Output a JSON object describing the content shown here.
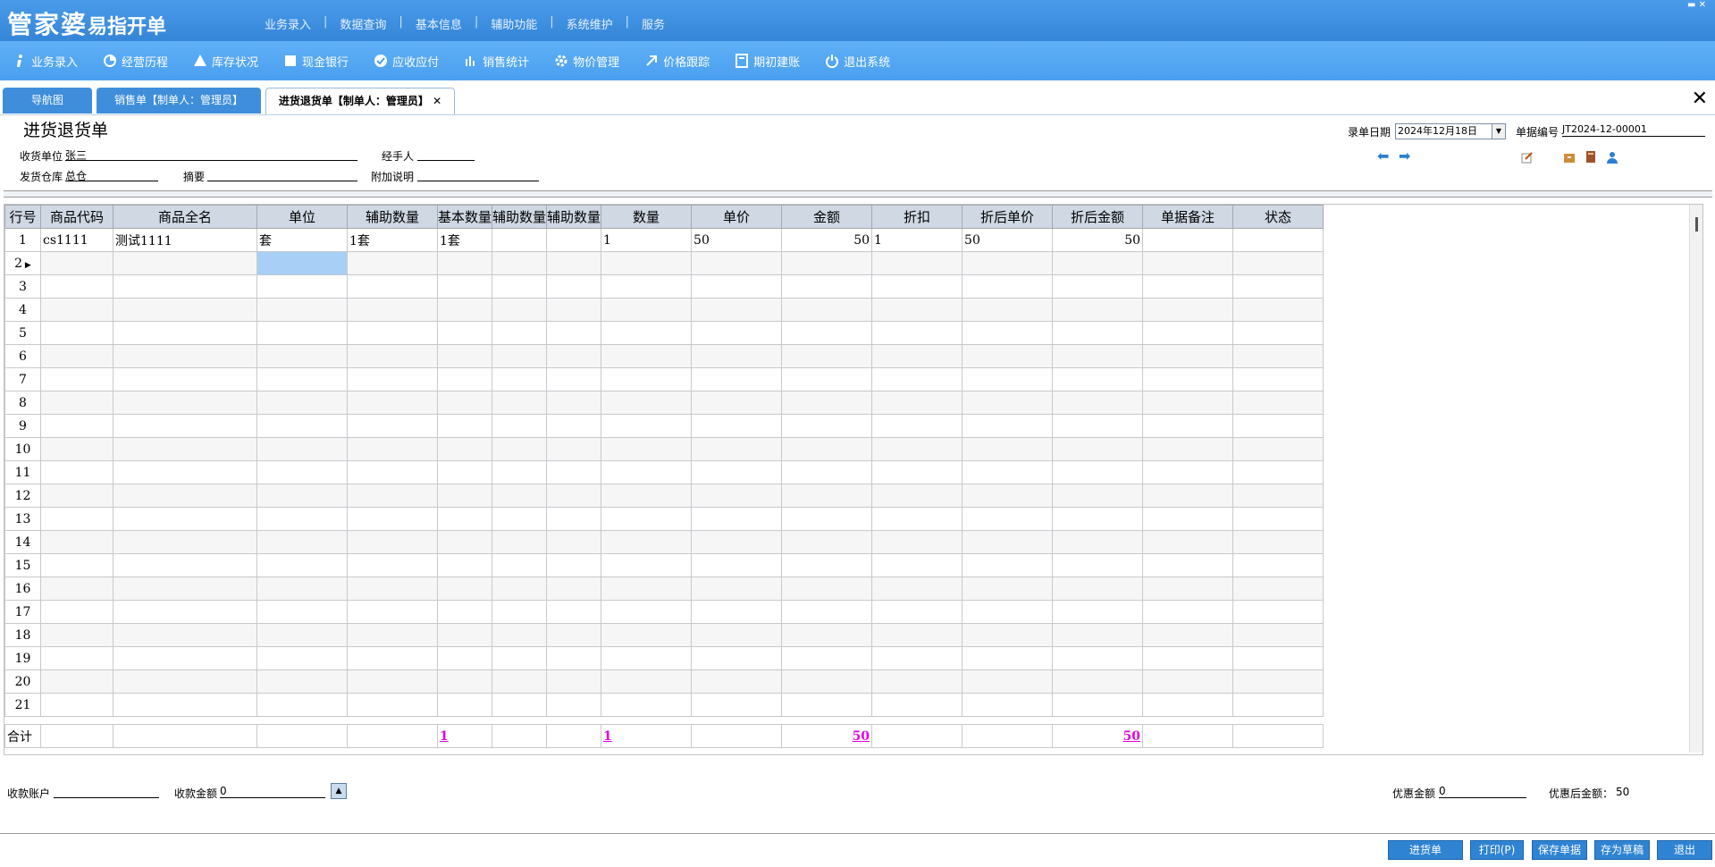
{
  "app": {
    "logo_big": "管家婆",
    "logo_small": "易指开单"
  },
  "top_menu": [
    "业务录入",
    "数据查询",
    "基本信息",
    "辅助功能",
    "系统维护",
    "服务"
  ],
  "toolbar": [
    "业务录入",
    "经营历程",
    "库存状况",
    "现金银行",
    "应收应付",
    "销售统计",
    "物价管理",
    "价格跟踪",
    "期初建账",
    "退出系统"
  ],
  "tabs": [
    "导航图",
    "销售单【制单人：管理员】",
    "进货退货单【制单人：管理员】"
  ],
  "tab_close": "✕",
  "form": {
    "title": "进货退货单",
    "supplier_label": "收货单位",
    "supplier": "张三",
    "handler_label": "经手人",
    "handler": "",
    "warehouse_label": "发货仓库",
    "warehouse": "总仓",
    "summary_label": "摘要",
    "summary": "",
    "note_label": "附加说明",
    "note": "",
    "date_label": "录单日期",
    "date": "2024年12月18日",
    "docno_label": "单据编号",
    "docno": "JT2024-12-00001"
  },
  "grid": {
    "columns": [
      "行号",
      "商品代码",
      "商品全名",
      "单位",
      "辅助数量",
      "基本数量",
      "辅助数量",
      "辅助数量",
      "数量",
      "单价",
      "金额",
      "折扣",
      "折后单价",
      "折后金额",
      "单据备注",
      "状态"
    ],
    "rows": [
      [
        "1",
        "cs1111",
        "测试1111",
        "套",
        "1套",
        "1套",
        "",
        "",
        "1",
        "50",
        "50",
        "1",
        "50",
        "50",
        "",
        ""
      ],
      [
        "2",
        "",
        "",
        "",
        "",
        "",
        "",
        "",
        "",
        "",
        "",
        "",
        "",
        "",
        "",
        ""
      ],
      [
        "3"
      ],
      [
        "4"
      ],
      [
        "5"
      ],
      [
        "6"
      ],
      [
        "7"
      ],
      [
        "8"
      ],
      [
        "9"
      ],
      [
        "10"
      ],
      [
        "11"
      ],
      [
        "12"
      ],
      [
        "13"
      ],
      [
        "14"
      ],
      [
        "15"
      ],
      [
        "16"
      ],
      [
        "17"
      ],
      [
        "18"
      ],
      [
        "19"
      ],
      [
        "20"
      ],
      [
        "21"
      ]
    ],
    "total_label": "合计",
    "totals": {
      "base_qty": "1",
      "qty": "1",
      "amount": "50",
      "disc_amount": "50"
    }
  },
  "footer": {
    "account_label": "收款账户",
    "account": "",
    "received_label": "收款金额",
    "received": "0",
    "discount_label": "优惠金额",
    "discount": "0",
    "after_discount_label": "优惠后金额：",
    "after_discount": "50"
  },
  "buttons": [
    "进货单",
    "打印(P)",
    "保存单据",
    "存为草稿",
    "退出"
  ]
}
